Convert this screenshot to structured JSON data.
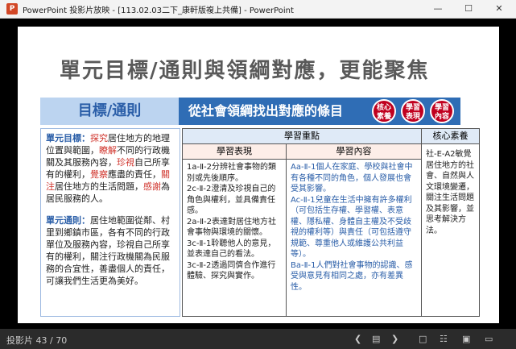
{
  "window": {
    "title": "PowerPoint 投影片放映 - [113.02.03二下_康軒版複上共備] - PowerPoint",
    "minimize": "—",
    "maximize": "☐",
    "close": "✕"
  },
  "slide": {
    "title": "單元目標/通則與領綱對應，更能聚焦",
    "left_header": "目標/通則",
    "right_header": "從社會領綱找出對應的條目",
    "badges": [
      "核心素養",
      "學習表現",
      "學習內容"
    ],
    "goal": {
      "label": "單元目標：",
      "text_parts": [
        "探究",
        "居住地方的地理位置與範圍，",
        "瞭解",
        "不同的行政機關及其服務內容，",
        "珍視",
        "自己所享有的權利，",
        "覺察",
        "應盡的責任，",
        "關注",
        "居住地方的生活問題，",
        "感謝",
        "為居民服務的人。"
      ]
    },
    "principle": {
      "label": "單元通則：",
      "text": "居住地範圍從鄰、村里到鄉鎮市區，各有不同的行政單位及服務內容，珍視自己所享有的權利，關注行政機關為民服務的合宜性，善盡個人的責任，可讓我們生活更為美好。"
    },
    "table": {
      "learning_focus": "學習重點",
      "core": "核心素養",
      "performance_title": "學習表現",
      "content_title": "學習內容",
      "performance": [
        "1a-Ⅱ-2分辨社會事物的類別或先後順序。",
        "2c-Ⅱ-2澄清及珍視自己的角色與權利，並具備責任感。",
        "2a-Ⅱ-2表達對居住地方社會事物與環境的關懷。",
        "3c-Ⅱ-1聆聽他人的意見，並表達自己的看法。",
        "3c-Ⅱ-2透過同儕合作進行體驗、探究與實作。"
      ],
      "content": [
        "Aa-Ⅱ-1個人在家庭、學校與社會中有各種不同的角色，個人發展也會受其影響。",
        "Ac-Ⅱ-1兒童在生活中擁有許多權利（可包括生存權、學習權、表意權、隱私權、身體自主權及不受歧視的權利等）與責任（可包括遵守規範、尊重他人或維護公共利益等）。",
        "Ba-Ⅱ-1人們對社會事物的認識、感受與意見有相同之處，亦有差異性。"
      ],
      "core_text": "社-E-A2敏覺居住地方的社會、自然與人文環境變遷，關注生活問題及其影響，並思考解決方法。"
    }
  },
  "status": {
    "slide_counter": "投影片 43 / 70"
  },
  "colors": {
    "accent_blue": "#2f6db5",
    "badge_red": "#c0001f",
    "highlight_red": "#d0342c"
  }
}
